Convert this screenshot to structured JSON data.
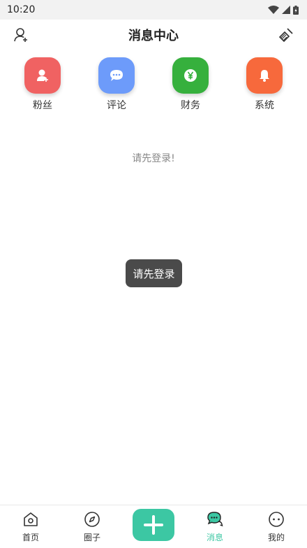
{
  "status": {
    "time": "10:20"
  },
  "header": {
    "title": "消息中心"
  },
  "categories": [
    {
      "label": "粉丝",
      "color": "#f06262",
      "icon": "user-plus-icon"
    },
    {
      "label": "评论",
      "color": "#6d9bfa",
      "icon": "chat-bubble-icon"
    },
    {
      "label": "财务",
      "color": "#36b03d",
      "icon": "yen-coin-icon"
    },
    {
      "label": "系统",
      "color": "#f7693c",
      "icon": "bell-icon"
    }
  ],
  "content": {
    "empty_text": "请先登录!"
  },
  "toast": {
    "text": "请先登录"
  },
  "tabbar": {
    "active_color": "#3cc7a3",
    "tabs": [
      {
        "label": "首页",
        "icon": "home-icon"
      },
      {
        "label": "圈子",
        "icon": "compass-icon"
      },
      {
        "label": "",
        "icon": "plus-icon"
      },
      {
        "label": "消息",
        "icon": "message-icon"
      },
      {
        "label": "我的",
        "icon": "profile-icon"
      }
    ]
  }
}
